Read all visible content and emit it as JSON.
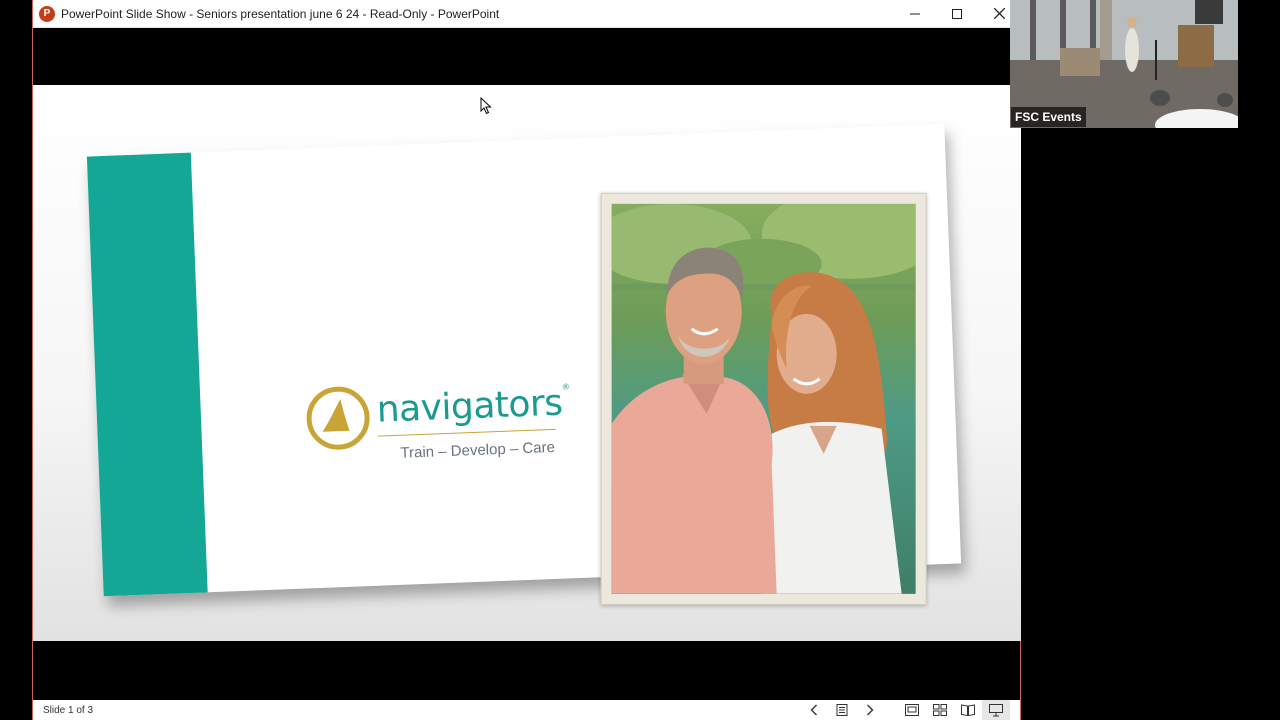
{
  "window": {
    "title": "PowerPoint Slide Show  -  Seniors presentation june 6 24  -  Read-Only - PowerPoint",
    "app_icon_letter": "P"
  },
  "slide": {
    "logo_word": "navigators",
    "logo_reg": "®",
    "tagline": "Train – Develop – Care"
  },
  "statusbar": {
    "slide_counter": "Slide 1 of 3"
  },
  "video": {
    "label": "FSC Events"
  },
  "colors": {
    "teal": "#14a795",
    "logo_gold": "#c9a437",
    "logo_teal": "#1a9a90",
    "ppt_red": "#c43e1c"
  },
  "icons": [
    "minimize-icon",
    "maximize-icon",
    "close-icon",
    "previous-slide-icon",
    "slide-menu-icon",
    "next-slide-icon",
    "normal-view-icon",
    "slide-sorter-icon",
    "reading-view-icon",
    "slide-show-icon",
    "mouse-cursor-icon"
  ]
}
